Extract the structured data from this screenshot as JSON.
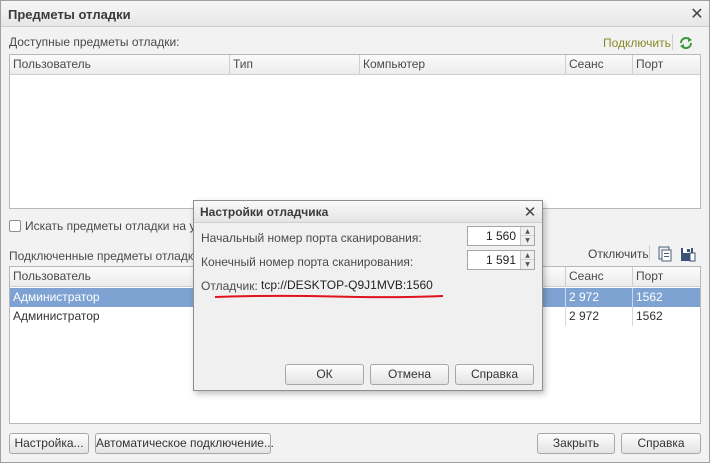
{
  "window": {
    "title": "Предметы отладки"
  },
  "available": {
    "label": "Доступные предметы отладки:",
    "connect_label": "Подключить",
    "columns": [
      "Пользователь",
      "Тип",
      "Компьютер",
      "Сеанс",
      "Порт"
    ]
  },
  "search_remote": {
    "label": "Искать предметы отладки на уда",
    "checked": false
  },
  "connected": {
    "label": "Подключенные предметы отладки:",
    "disconnect_label": "Отключить",
    "columns": [
      "Пользователь",
      "Сеанс",
      "Порт"
    ],
    "rows": [
      {
        "user": "Администратор",
        "session": "2 972",
        "port": "1562",
        "selected": true
      },
      {
        "user": "Администратор",
        "session": "2 972",
        "port": "1562",
        "selected": false
      }
    ]
  },
  "footer": {
    "settings_label": "Настройка...",
    "auto_connect_label": "Автоматическое подключение...",
    "close_label": "Закрыть",
    "help_label": "Справка"
  },
  "dialog": {
    "title": "Настройки отладчика",
    "start_port_label": "Начальный номер порта сканирования:",
    "start_port_value": "1 560",
    "end_port_label": "Конечный номер порта сканирования:",
    "end_port_value": "1 591",
    "debugger_label": "Отладчик:",
    "debugger_value": "tcp://DESKTOP-Q9J1MVB:1560",
    "ok_label": "ОК",
    "cancel_label": "Отмена",
    "help_label": "Справка"
  },
  "colors": {
    "selected_row": "#7ea3d2",
    "annotation": "#e0141e",
    "refresh_icon": "#3a9a3a"
  },
  "icons": [
    "close-icon",
    "refresh-icon",
    "copy-icon",
    "save-icon",
    "spin-up-icon",
    "spin-down-icon"
  ]
}
